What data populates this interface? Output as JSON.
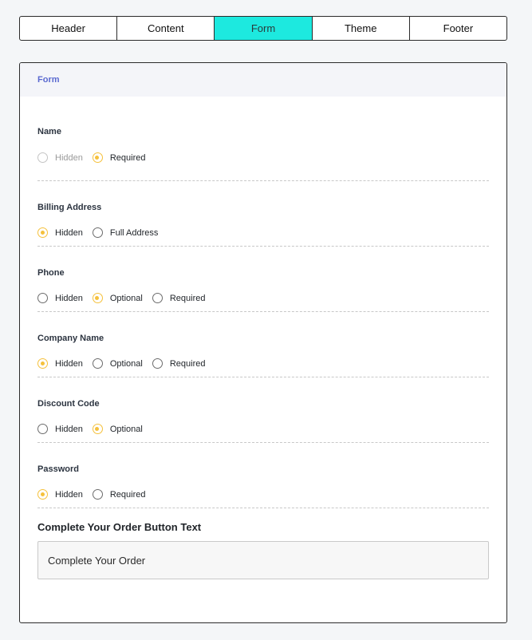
{
  "tabs": [
    {
      "label": "Header",
      "active": false
    },
    {
      "label": "Content",
      "active": false
    },
    {
      "label": "Form",
      "active": true
    },
    {
      "label": "Theme",
      "active": false
    },
    {
      "label": "Footer",
      "active": false
    }
  ],
  "panel": {
    "title": "Form"
  },
  "sections": [
    {
      "title": "Name",
      "options": [
        {
          "label": "Hidden",
          "checked": false,
          "disabled": true
        },
        {
          "label": "Required",
          "checked": true,
          "disabled": false
        }
      ]
    },
    {
      "title": "Billing Address",
      "options": [
        {
          "label": "Hidden",
          "checked": true,
          "disabled": false
        },
        {
          "label": "Full Address",
          "checked": false,
          "disabled": false
        }
      ]
    },
    {
      "title": "Phone",
      "options": [
        {
          "label": "Hidden",
          "checked": false,
          "disabled": false
        },
        {
          "label": "Optional",
          "checked": true,
          "disabled": false
        },
        {
          "label": "Required",
          "checked": false,
          "disabled": false
        }
      ]
    },
    {
      "title": "Company Name",
      "options": [
        {
          "label": "Hidden",
          "checked": true,
          "disabled": false
        },
        {
          "label": "Optional",
          "checked": false,
          "disabled": false
        },
        {
          "label": "Required",
          "checked": false,
          "disabled": false
        }
      ]
    },
    {
      "title": "Discount Code",
      "options": [
        {
          "label": "Hidden",
          "checked": false,
          "disabled": false
        },
        {
          "label": "Optional",
          "checked": true,
          "disabled": false
        }
      ]
    },
    {
      "title": "Password",
      "options": [
        {
          "label": "Hidden",
          "checked": true,
          "disabled": false
        },
        {
          "label": "Required",
          "checked": false,
          "disabled": false
        }
      ]
    }
  ],
  "button_text": {
    "title": "Complete Your Order Button Text",
    "value": "Complete Your Order"
  },
  "colors": {
    "active_tab": "#1de9df",
    "radio_checked": "#f5c13c",
    "panel_title": "#5b6ad0"
  }
}
